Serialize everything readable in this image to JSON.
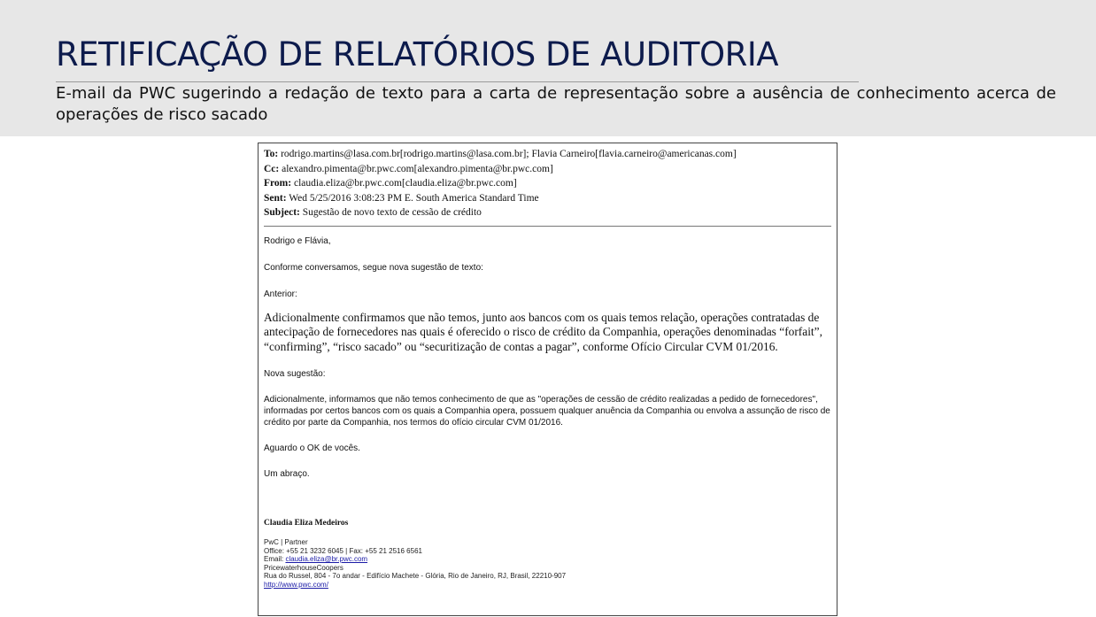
{
  "slide": {
    "title": "RETIFICAÇÃO DE RELATÓRIOS DE AUDITORIA",
    "subtitle": "E-mail da PWC sugerindo a redação de texto para a carta de representação sobre a ausência de conhecimento acerca de operações de risco sacado"
  },
  "email": {
    "header": {
      "to_label": "To:",
      "to_value": "rodrigo.martins@lasa.com.br[rodrigo.martins@lasa.com.br]; Flavia Carneiro[flavia.carneiro@americanas.com]",
      "cc_label": "Cc:",
      "cc_value": "alexandro.pimenta@br.pwc.com[alexandro.pimenta@br.pwc.com]",
      "from_label": "From:",
      "from_value": "claudia.eliza@br.pwc.com[claudia.eliza@br.pwc.com]",
      "sent_label": "Sent:",
      "sent_value": "Wed 5/25/2016 3:08:23 PM E. South America Standard Time",
      "subject_label": "Subject:",
      "subject_value": "Sugestão de novo texto de cessão de crédito"
    },
    "body": {
      "greeting": "Rodrigo e Flávia,",
      "intro": "Conforme conversamos, segue nova sugestão de texto:",
      "previous_label": "Anterior:",
      "previous_text": "Adicionalmente confirmamos que não temos, junto aos bancos com os quais temos relação, operações contratadas de antecipação de fornecedores nas quais é oferecido o risco de crédito da Companhia, operações denominadas “forfait”, “confirming”, “risco sacado” ou “securitização de contas a pagar”, conforme Ofício Circular CVM 01/2016.",
      "new_label": "Nova sugestão:",
      "new_text": "Adicionalmente, informamos que não temos conhecimento de que as \"operações de cessão de crédito realizadas a pedido de fornecedores\", informadas por certos bancos com os quais a Companhia opera, possuem qualquer anuência da Companhia ou envolva a assunção de risco de crédito por parte da Companhia, nos termos do ofício circular CVM 01/2016.",
      "awaiting": "Aguardo o OK de vocês.",
      "closing": "Um abraço."
    },
    "signature": {
      "name": "Claudia Eliza Medeiros",
      "role": "PwC | Partner",
      "phones": "Office: +55 21 3232 6045 | Fax: +55 21 2516 6561",
      "email_label": "Email: ",
      "email_link": "claudia.eliza@br.pwc.com",
      "company": "PricewaterhouseCoopers",
      "address": "Rua do Russel, 804 - 7o andar - Edifício Machete - Glória, Rio de Janeiro, RJ, Brasil, 22210-907",
      "website": "http://www.pwc.com/"
    }
  }
}
